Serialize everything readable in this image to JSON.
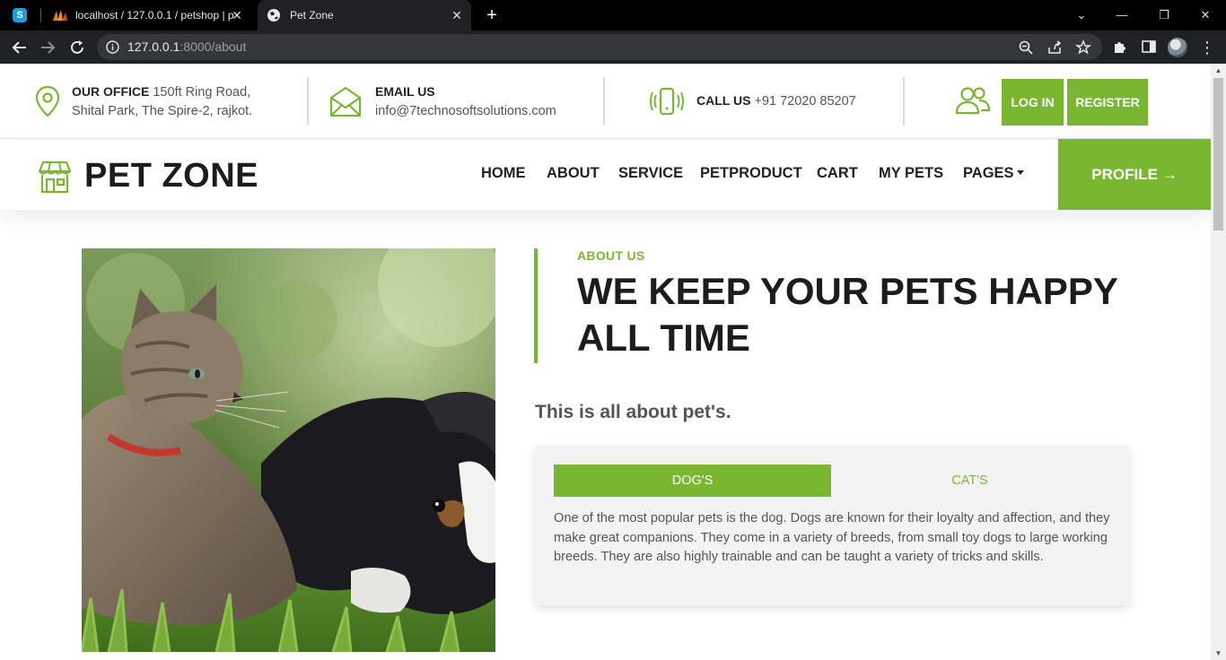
{
  "browser": {
    "tabs": [
      {
        "title": "",
        "icon": "skype-icon"
      },
      {
        "title": "localhost / 127.0.0.1 / petshop | p",
        "icon": "phpmyadmin-icon"
      },
      {
        "title": "Pet Zone",
        "icon": "globe-icon",
        "active": true
      }
    ],
    "url_host": "127.0.0.1",
    "url_path": ":8000/about",
    "new_tab_label": "+",
    "close_label": "✕"
  },
  "topbar": {
    "office_label": "OUR OFFICE",
    "office_line1": " 150ft Ring Road,",
    "office_line2": "Shital Park, The Spire-2, rajkot.",
    "email_label": "EMAIL US",
    "email_value": "info@7technosoftsolutions.com",
    "call_label": "CALL US",
    "call_value": " +91 72020 85207",
    "login_label": "LOG IN",
    "register_label": "REGISTER"
  },
  "navbar": {
    "brand": "PET ZONE",
    "links": [
      "HOME",
      "ABOUT",
      "SERVICE",
      "PETPRODUCT",
      "CART",
      "MY PETS",
      "PAGES"
    ],
    "profile_label": "PROFILE →"
  },
  "about": {
    "eyebrow": "ABOUT US",
    "headline": "WE KEEP YOUR PETS HAPPY ALL TIME",
    "lead": "This is all about pet's.",
    "tabs": [
      "DOG'S",
      "CAT'S"
    ],
    "active_tab": "DOG'S",
    "tab_text": "One of the most popular pets is the dog. Dogs are known for their loyalty and affection, and they make great companions. They come in a variety of breeds, from small toy dogs to large working breeds. They are also highly trainable and can be taught a variety of tricks and skills."
  },
  "colors": {
    "accent": "#7ab730",
    "dark": "#1c1c1c",
    "text": "#555555"
  }
}
